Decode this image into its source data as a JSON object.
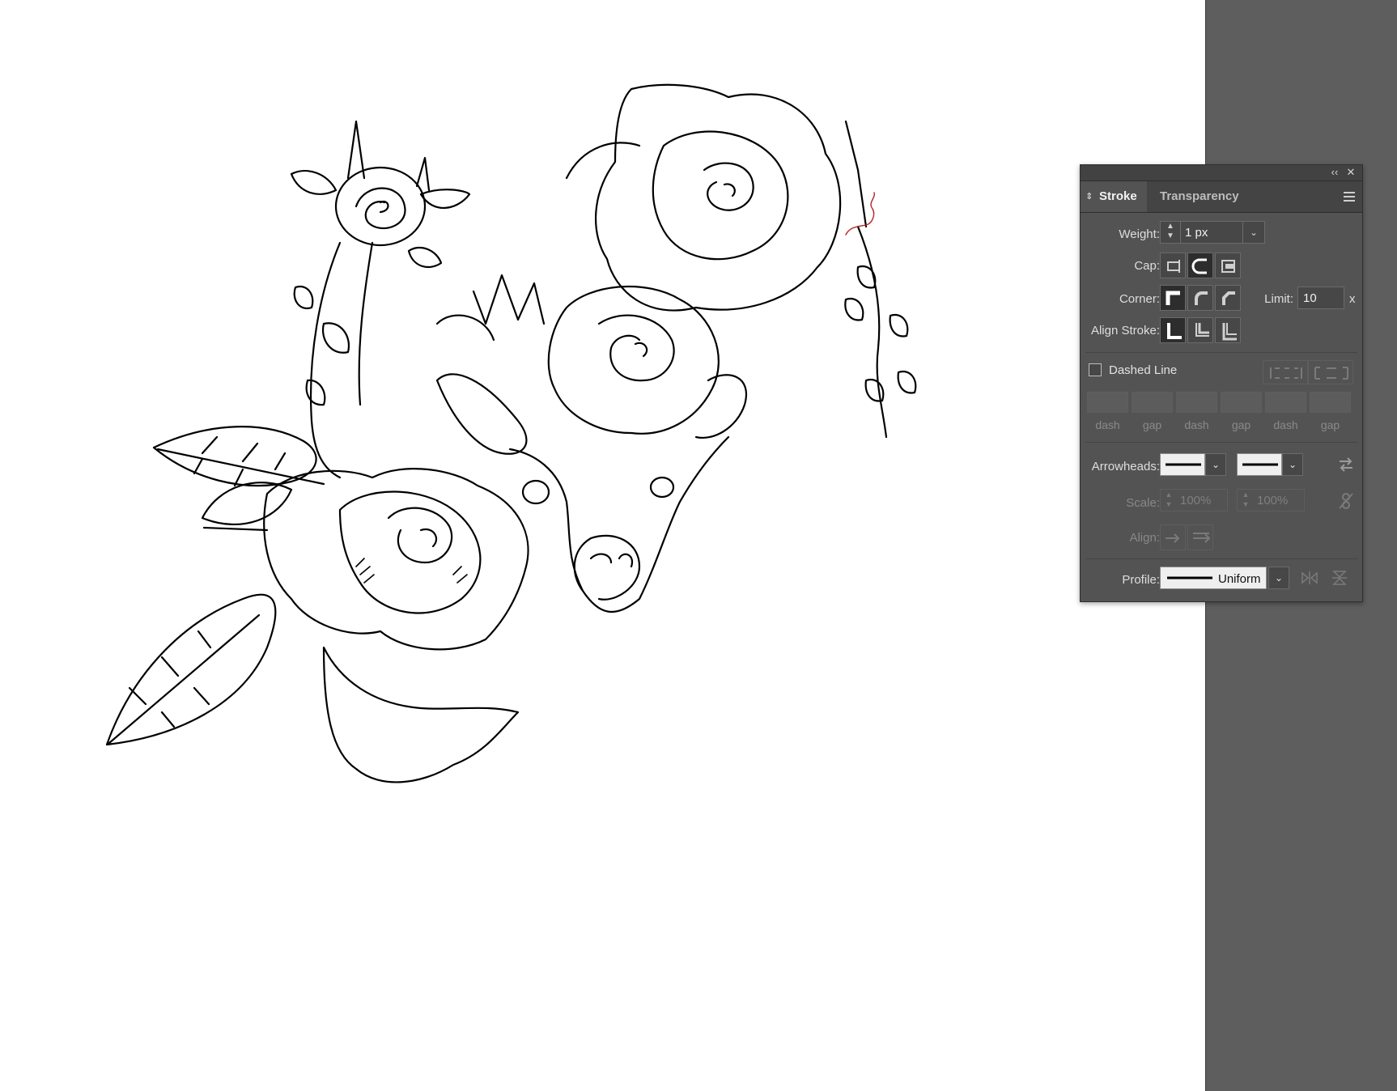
{
  "panel": {
    "tabs": {
      "stroke": "Stroke",
      "transparency": "Transparency"
    },
    "weight": {
      "label": "Weight:",
      "value": "1 px"
    },
    "cap": {
      "label": "Cap:"
    },
    "corner": {
      "label": "Corner:"
    },
    "limit": {
      "label": "Limit:",
      "value": "10",
      "suffix": "x"
    },
    "align_stroke": {
      "label": "Align Stroke:"
    },
    "dashed": {
      "label": "Dashed Line",
      "checked": false
    },
    "dash_slots": [
      "dash",
      "gap",
      "dash",
      "gap",
      "dash",
      "gap"
    ],
    "arrowheads": {
      "label": "Arrowheads:"
    },
    "scale": {
      "label": "Scale:",
      "start": "100%",
      "end": "100%"
    },
    "align": {
      "label": "Align:"
    },
    "profile": {
      "label": "Profile:",
      "value": "Uniform"
    }
  },
  "icons": {
    "collapse": "double-chevron-left-icon",
    "close": "close-icon",
    "menu": "hamburger-menu-icon",
    "tab_toggle": "up-down-arrows-icon"
  },
  "colors": {
    "artboard": "#ffffff",
    "pasteboard": "#5e5e5e",
    "panel_bg": "#535353",
    "selection_path": "#b32525"
  }
}
